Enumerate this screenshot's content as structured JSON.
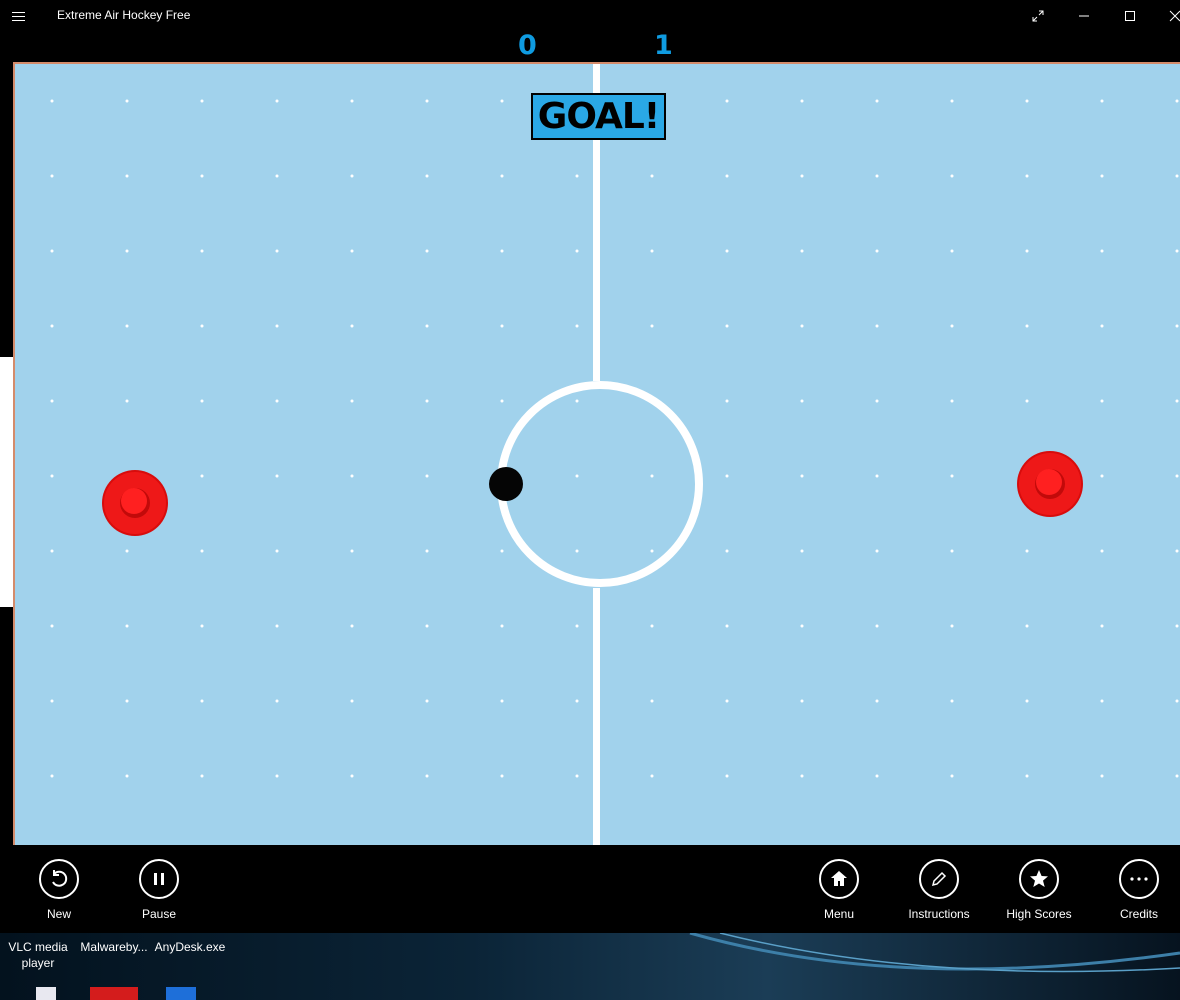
{
  "window": {
    "title": "Extreme Air Hockey Free"
  },
  "score": {
    "left": "0",
    "right": "1"
  },
  "game": {
    "banner": "GOAL!"
  },
  "commands": {
    "new": "New",
    "pause": "Pause",
    "menu": "Menu",
    "instructions": "Instructions",
    "high_scores": "High Scores",
    "credits": "Credits"
  },
  "desktop": {
    "icons": [
      "VLC media player",
      "Malwareby...",
      "AnyDesk.exe"
    ]
  },
  "colors": {
    "rink": "#a1d2ec",
    "score": "#0f9be0",
    "banner": "#2aa8e6",
    "mallet": "#e81010"
  }
}
